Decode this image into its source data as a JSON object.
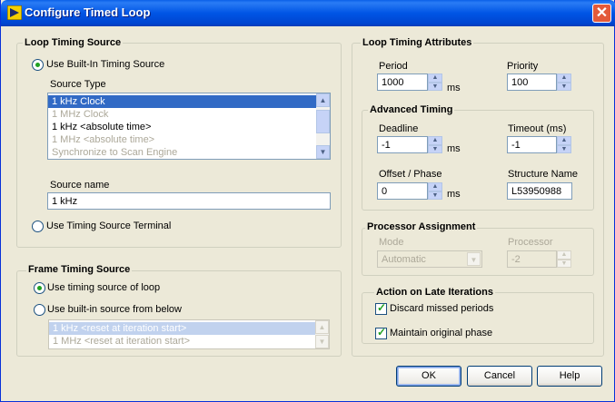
{
  "window": {
    "title": "Configure Timed Loop",
    "close_glyph": "✕"
  },
  "loop_timing_source": {
    "title": "Loop Timing Source",
    "use_builtin_label": "Use Built-In Timing Source",
    "source_type_label": "Source Type",
    "source_types": [
      "1 kHz Clock",
      "1 MHz Clock",
      "1 kHz <absolute time>",
      "1 MHz <absolute time>",
      "Synchronize to Scan Engine"
    ],
    "selected_index": 0,
    "source_name_label": "Source name",
    "source_name_value": "1 kHz",
    "use_terminal_label": "Use Timing Source Terminal",
    "selected_option": "builtin"
  },
  "frame_timing_source": {
    "title": "Frame Timing Source",
    "use_loop_label": "Use timing source of loop",
    "use_builtin_label": "Use built-in source from below",
    "sources": [
      "1 kHz <reset at iteration start>",
      "1 MHz <reset at iteration start>"
    ],
    "selected_option": "loop"
  },
  "loop_timing_attributes": {
    "title": "Loop Timing Attributes",
    "period_label": "Period",
    "period_value": "1000",
    "period_unit": "ms",
    "priority_label": "Priority",
    "priority_value": "100"
  },
  "advanced_timing": {
    "title": "Advanced Timing",
    "deadline_label": "Deadline",
    "deadline_value": "-1",
    "deadline_unit": "ms",
    "timeout_label": "Timeout (ms)",
    "timeout_value": "-1",
    "offset_label": "Offset / Phase",
    "offset_value": "0",
    "offset_unit": "ms",
    "structure_name_label": "Structure Name",
    "structure_name_value": "L53950988"
  },
  "processor_assignment": {
    "title": "Processor Assignment",
    "mode_label": "Mode",
    "mode_value": "Automatic",
    "processor_label": "Processor",
    "processor_value": "-2"
  },
  "late_iterations": {
    "title": "Action on Late Iterations",
    "discard_label": "Discard missed periods",
    "discard_checked": true,
    "maintain_label": "Maintain original phase",
    "maintain_checked": true
  },
  "buttons": {
    "ok": "OK",
    "cancel": "Cancel",
    "help": "Help"
  },
  "colors": {
    "titlebar": "#0055e5",
    "face": "#ece9d8",
    "selection": "#316ac5",
    "radio_dot": "#21a121"
  }
}
